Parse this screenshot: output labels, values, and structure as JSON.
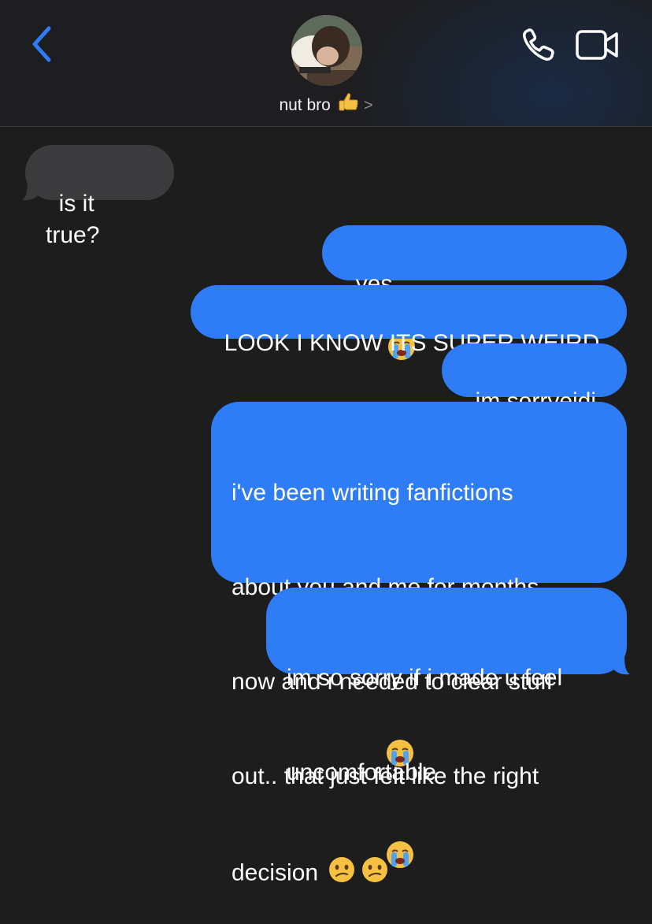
{
  "header": {
    "contact_name": "nut bro",
    "chevron": ">",
    "back_icon": "chevron-left-icon",
    "phone_icon": "phone-icon",
    "video_icon": "video-camera-icon",
    "accent_color": "#2e7cf6"
  },
  "messages": [
    {
      "direction": "incoming",
      "text": "is it true?"
    },
    {
      "direction": "outgoing",
      "text": "yes",
      "emoji": "loudly-crying-face x6"
    },
    {
      "direction": "outgoing",
      "text": "LOOK I KNOW ITS SUPER WEIRD"
    },
    {
      "direction": "outgoing",
      "text": "im sorryejdj"
    },
    {
      "direction": "outgoing",
      "text_lines": [
        "i've been writing fanfictions",
        "about you and me for months",
        "now and i needed to clear stuff",
        "out.. that just felt like the right",
        "decision"
      ],
      "emoji": "confused-face x2"
    },
    {
      "direction": "outgoing",
      "text_lines": [
        "im so sorry if i made u feel",
        "uncomfortable"
      ]
    }
  ],
  "colors": {
    "background": "#1d1d1e",
    "incoming_bubble": "#3b3b3d",
    "outgoing_bubble": "#2e7cf6",
    "text": "#ffffff"
  }
}
